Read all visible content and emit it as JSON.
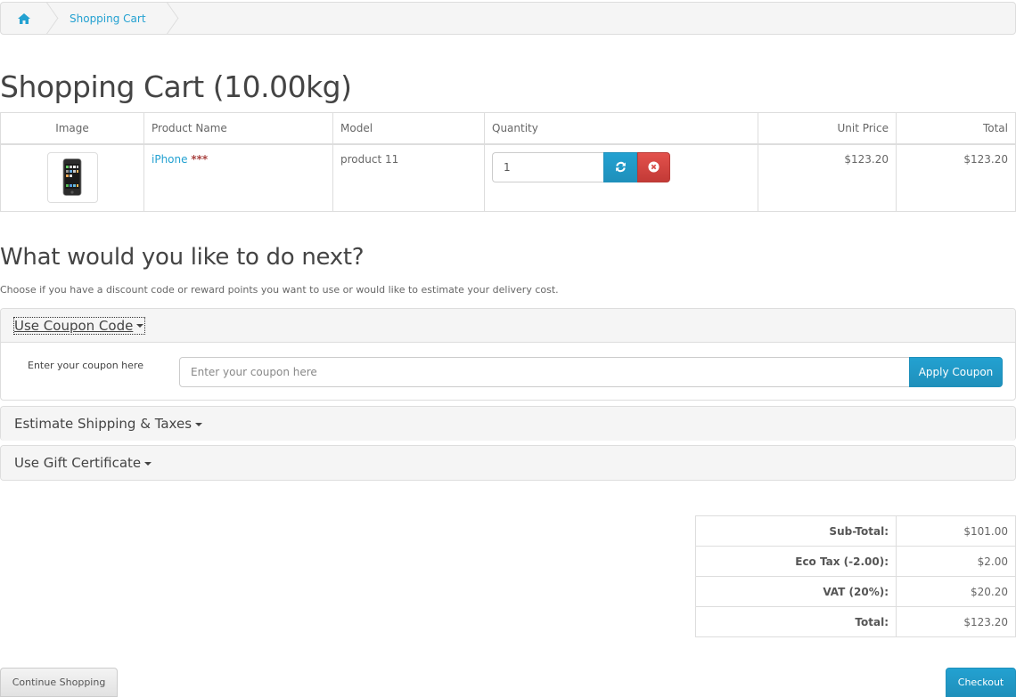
{
  "breadcrumb": {
    "home_icon": "home-icon",
    "items": [
      {
        "label": "Shopping Cart"
      }
    ]
  },
  "page_title": "Shopping Cart  (10.00kg)",
  "cart_table": {
    "headers": {
      "image": "Image",
      "name": "Product Name",
      "model": "Model",
      "quantity": "Quantity",
      "unit_price": "Unit Price",
      "total": "Total"
    },
    "rows": [
      {
        "image_icon": "iphone-thumbnail",
        "name": "iPhone",
        "stock_flag": "***",
        "model": "product 11",
        "quantity": "1",
        "unit_price": "$123.20",
        "total": "$123.20",
        "update_icon": "refresh-icon",
        "remove_icon": "remove-circle-icon"
      }
    ]
  },
  "next_section": {
    "title": "What would you like to do next?",
    "intro": "Choose if you have a discount code or reward points you want to use or would like to estimate your delivery cost."
  },
  "panels": {
    "coupon": {
      "title": "Use Coupon Code",
      "label": "Enter your coupon here",
      "placeholder": "Enter your coupon here",
      "value": "",
      "button": "Apply Coupon"
    },
    "shipping": {
      "title": "Estimate Shipping & Taxes"
    },
    "gift": {
      "title": "Use Gift Certificate"
    }
  },
  "totals": [
    {
      "label": "Sub-Total:",
      "value": "$101.00"
    },
    {
      "label": "Eco Tax (-2.00):",
      "value": "$2.00"
    },
    {
      "label": "VAT (20%):",
      "value": "$20.20"
    },
    {
      "label": "Total:",
      "value": "$123.20"
    }
  ],
  "buttons": {
    "continue": "Continue Shopping",
    "checkout": "Checkout"
  },
  "colors": {
    "primary": "#23a1d1",
    "danger": "#d9534f",
    "link": "#23a1d1"
  }
}
